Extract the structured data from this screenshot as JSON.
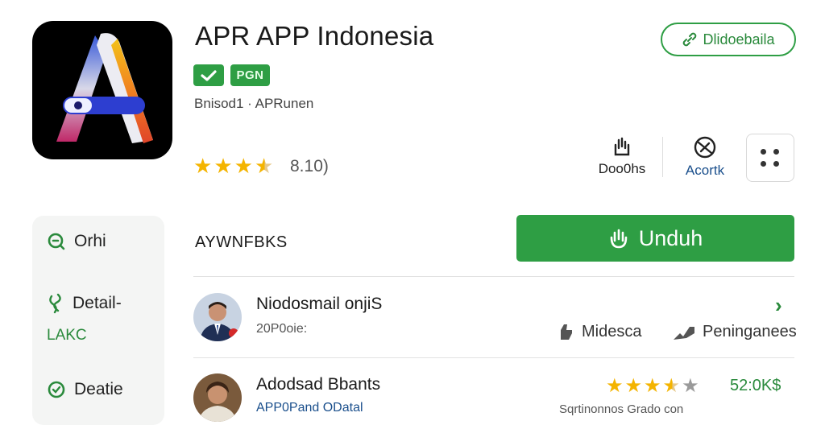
{
  "app": {
    "title": "APR APP Indonesia",
    "badge_pgn": "PGN",
    "meta": "Bnisod1 · APRunen",
    "rating_count": "8.10)"
  },
  "top_pill": {
    "label": "Dlidoebaila"
  },
  "actions": {
    "download_label": "Doo0hs",
    "report_label": "Acortk"
  },
  "sidebar": {
    "items": [
      {
        "label": "Orhi"
      },
      {
        "label": "Detail-",
        "sub": "LAKC"
      },
      {
        "label": "Deatie"
      }
    ]
  },
  "section": {
    "title": "AYWNFBKS"
  },
  "install": {
    "label": "Unduh"
  },
  "reviews": [
    {
      "name": "Niodosmail onjiS",
      "sub": "20P0oie:",
      "action1": "Midesca",
      "action2": "Peninganees"
    },
    {
      "name": "Adodsad Bbants",
      "sub": "APP0Pand  ODatal",
      "rating_count": "52:0K$",
      "note": "Sqrtinonnos Grado con"
    }
  ],
  "colors": {
    "accent": "#2e9e44",
    "star": "#f4b400",
    "link": "#1a4f8c"
  }
}
